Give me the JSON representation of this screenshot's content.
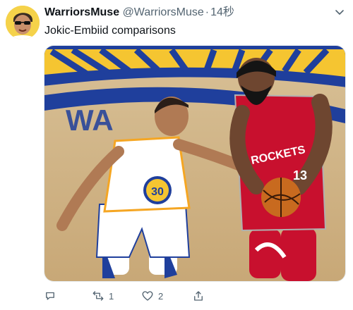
{
  "tweet": {
    "display_name": "WarriorsMuse",
    "handle": "@WarriorsMuse",
    "separator": "·",
    "time": "14秒",
    "text": "Jokic-Embiid comparisons",
    "media": {
      "left_jersey_number": "30",
      "right_jersey_text": "ROCKETS",
      "right_jersey_number": "13"
    },
    "actions": {
      "reply_icon": "reply-icon",
      "retweet_icon": "retweet-icon",
      "retweet_count": "1",
      "like_icon": "like-icon",
      "like_count": "2",
      "share_icon": "share-icon"
    }
  },
  "colors": {
    "name_text": "#0f1419",
    "secondary_text": "#536471",
    "court_blue": "#1f3f9c",
    "court_yellow": "#f5c531",
    "rockets_red": "#c8102e",
    "warriors_gold": "#f5a623"
  }
}
